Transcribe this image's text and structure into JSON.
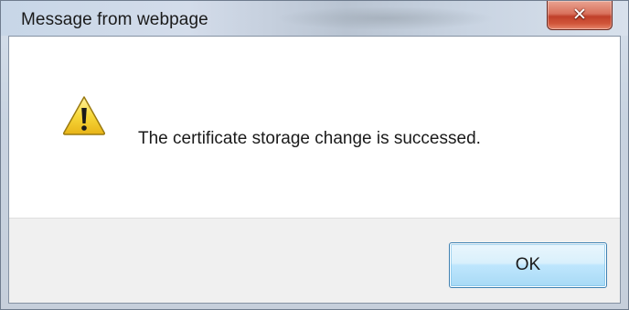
{
  "window": {
    "title": "Message from webpage",
    "close_icon": "close-icon",
    "close_glyph": "✕"
  },
  "content": {
    "icon": "warning-icon",
    "message": "The certificate storage change is successed."
  },
  "footer": {
    "ok_label": "OK"
  },
  "colors": {
    "close_button": "#c94a33",
    "ok_button_border": "#3c7fb1",
    "warning_fill": "#f6d233",
    "footer_bg": "#f0f0f0"
  }
}
